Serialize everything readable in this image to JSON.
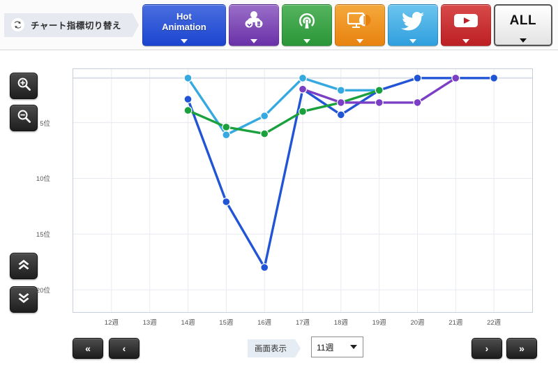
{
  "toolbar": {
    "refresh_icon": "refresh-swap-icon",
    "label": "チャート指標切り替え",
    "buttons": [
      {
        "name": "hot-animation",
        "label": "Hot\nAnimation",
        "label_line1": "Hot",
        "label_line2": "Animation",
        "color": "#1b45cf",
        "icon": "",
        "caret": "▼"
      },
      {
        "name": "community",
        "label": "",
        "color": "#6a31a8",
        "icon": "people-icon",
        "caret": "▼"
      },
      {
        "name": "broadcast",
        "label": "",
        "color": "#2a9637",
        "icon": "broadcast-icon",
        "caret": "▼"
      },
      {
        "name": "tv",
        "label": "",
        "color": "#e8820f",
        "icon": "tv-monitor-icon",
        "caret": "▼"
      },
      {
        "name": "twitter",
        "label": "",
        "color": "#2f9fdd",
        "icon": "twitter-bird-icon",
        "caret": "▼"
      },
      {
        "name": "youtube",
        "label": "",
        "color": "#bc1f24",
        "icon": "youtube-play-icon",
        "caret": "▼"
      },
      {
        "name": "all",
        "label": "ALL",
        "color": "#ffffff",
        "icon": "",
        "caret": "▼"
      }
    ]
  },
  "side_controls": {
    "zoom_in": {
      "icon": "zoom-in-magnifier-icon",
      "title": ""
    },
    "zoom_out": {
      "icon": "zoom-out-magnifier-icon",
      "title": ""
    },
    "page_up": {
      "icon": "double-chevron-up-icon",
      "title": ""
    },
    "page_down": {
      "icon": "double-chevron-down-icon",
      "title": ""
    }
  },
  "footer": {
    "first_label": "«",
    "prev_label": "‹",
    "next_label": "›",
    "last_label": "»",
    "display_label": "画面表示",
    "range_value": "11週",
    "range_options": [
      "11週"
    ]
  },
  "chart_data": {
    "type": "line",
    "title": "",
    "xlabel": "",
    "ylabel": "",
    "grid": true,
    "legend_position": "none",
    "categories": [
      "12週",
      "13週",
      "14週",
      "15週",
      "16週",
      "17週",
      "18週",
      "19週",
      "20週",
      "21週",
      "22週"
    ],
    "y_ticks": [
      5,
      10,
      15,
      20
    ],
    "y_tick_labels": [
      "5位",
      "10位",
      "15位",
      "20位"
    ],
    "ylim": [
      0.2,
      22
    ],
    "y_inverted": true,
    "series": [
      {
        "name": "light-blue-series",
        "color": "#35a9e0",
        "points": [
          {
            "x": "14週",
            "y": 1.0
          },
          {
            "x": "15週",
            "y": 6.1
          },
          {
            "x": "16週",
            "y": 4.4
          },
          {
            "x": "17週",
            "y": 1.0
          },
          {
            "x": "18週",
            "y": 2.1
          },
          {
            "x": "19週",
            "y": 2.1
          }
        ]
      },
      {
        "name": "dark-blue-series",
        "color": "#2255d6",
        "points": [
          {
            "x": "14週",
            "y": 2.9
          },
          {
            "x": "15週",
            "y": 12.1
          },
          {
            "x": "16週",
            "y": 18.0
          },
          {
            "x": "17週",
            "y": 2.0
          },
          {
            "x": "18週",
            "y": 4.3
          },
          {
            "x": "19週",
            "y": 2.1
          },
          {
            "x": "20週",
            "y": 1.0
          },
          {
            "x": "21週",
            "y": 1.0
          },
          {
            "x": "22週",
            "y": 1.0
          }
        ]
      },
      {
        "name": "green-series",
        "color": "#1aa03c",
        "points": [
          {
            "x": "14週",
            "y": 3.9
          },
          {
            "x": "15週",
            "y": 5.4
          },
          {
            "x": "16週",
            "y": 6.0
          },
          {
            "x": "17週",
            "y": 4.0
          },
          {
            "x": "18週",
            "y": 3.2
          },
          {
            "x": "19週",
            "y": 2.1
          }
        ]
      },
      {
        "name": "purple-series",
        "color": "#7a3fc4",
        "points": [
          {
            "x": "17週",
            "y": 2.0
          },
          {
            "x": "18週",
            "y": 3.2
          },
          {
            "x": "19週",
            "y": 3.2
          },
          {
            "x": "20週",
            "y": 3.2
          },
          {
            "x": "21週",
            "y": 1.0
          }
        ]
      }
    ]
  }
}
